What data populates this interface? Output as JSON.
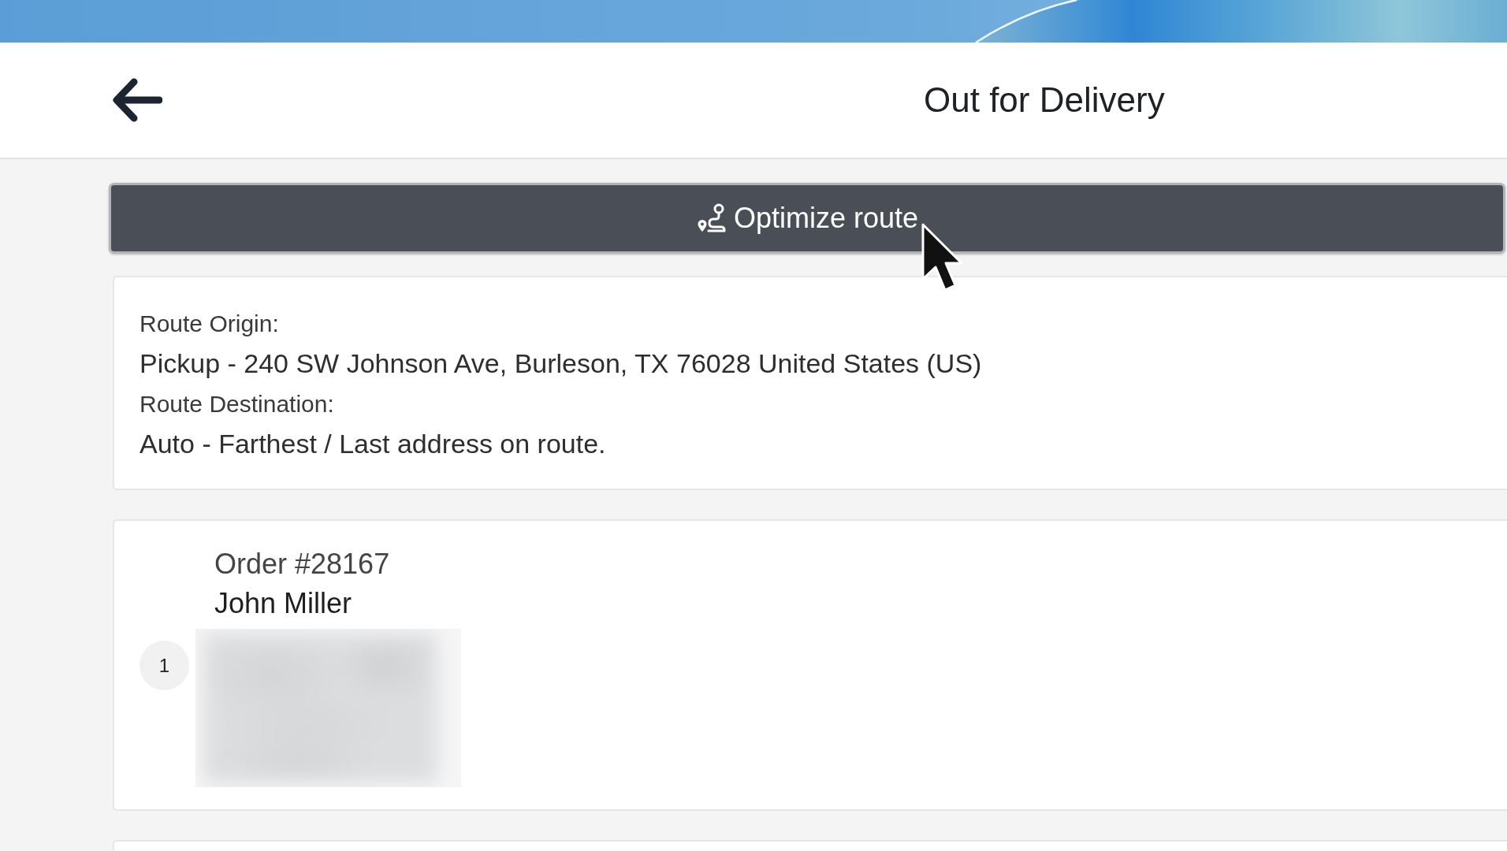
{
  "header": {
    "title": "Out for Delivery"
  },
  "optimize_button": {
    "label": "Optimize route"
  },
  "route_card": {
    "fields": [
      {
        "label": "Route Origin:",
        "value": "Pickup - 240 SW Johnson Ave, Burleson, TX 76028 United States (US)"
      },
      {
        "label": "Route Destination:",
        "value": "Auto - Farthest / Last address on route."
      }
    ]
  },
  "stops": [
    {
      "number": "1",
      "order": "Order #28167",
      "customer": "John Miller"
    }
  ]
}
